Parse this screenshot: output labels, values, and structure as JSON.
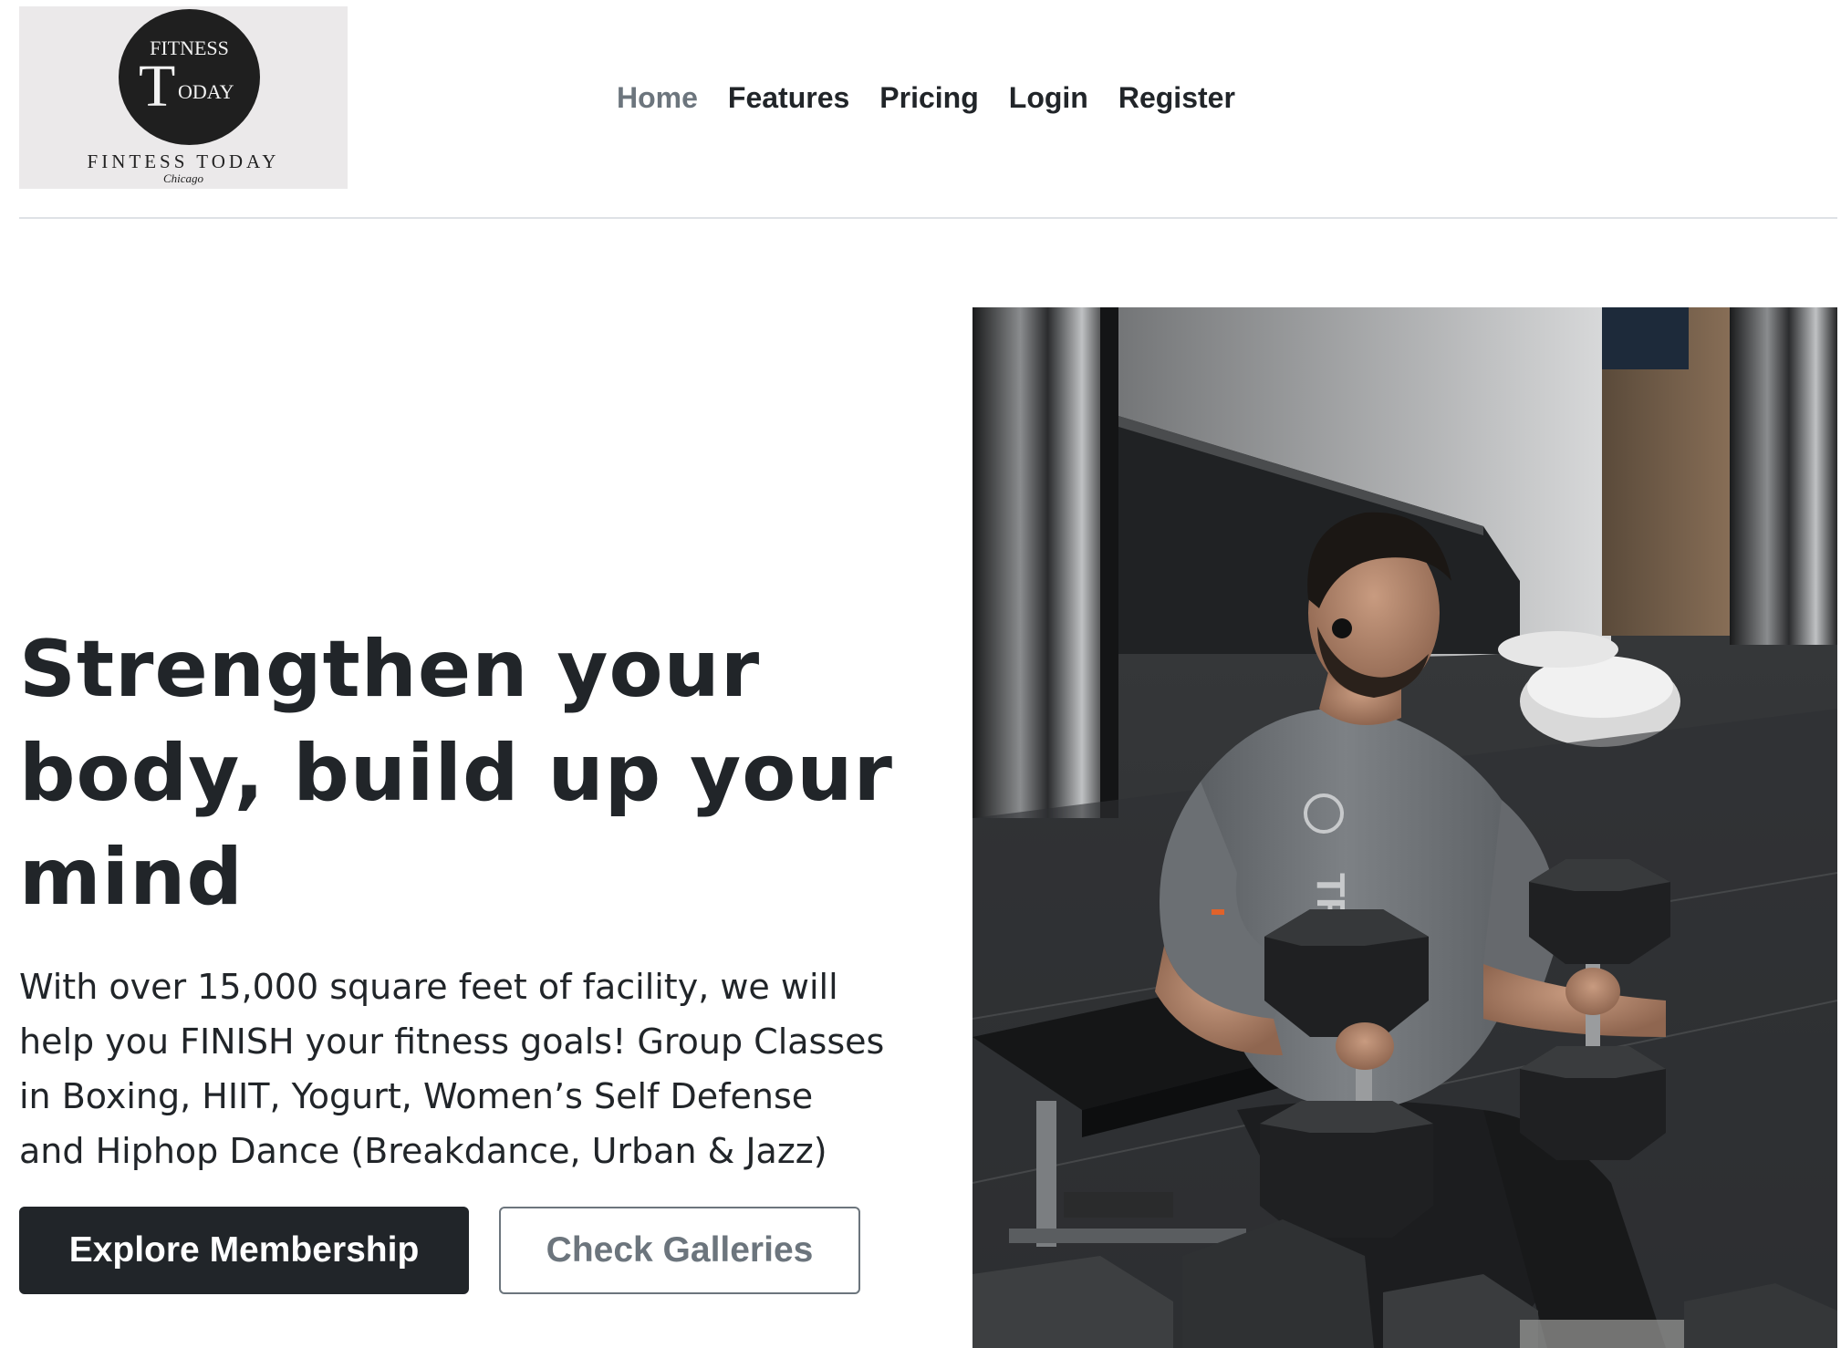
{
  "logo": {
    "top_text": "FITNESS",
    "big_letter": "T",
    "rest_text": "ODAY",
    "name": "FINTESS TODAY",
    "city": "Chicago",
    "colors": {
      "background": "#ebe9ea",
      "circle": "#1f1f1f"
    }
  },
  "nav": {
    "items": [
      {
        "label": "Home",
        "active": true
      },
      {
        "label": "Features",
        "active": false
      },
      {
        "label": "Pricing",
        "active": false
      },
      {
        "label": "Login",
        "active": false
      },
      {
        "label": "Register",
        "active": false
      }
    ]
  },
  "hero": {
    "title": "Strengthen your body, build up your mind",
    "description": "With over 15,000 square feet of facility, we will help you FINISH your fitness goals! Group Classes in Boxing, HIIT, Yogurt, Women’s Self Defense and Hiphop Dance (Breakdance, Urban & Jazz)",
    "primary_button": "Explore Membership",
    "secondary_button": "Check Galleries",
    "image_icon": "man-lifting-dumbbells-photo",
    "shirt_print": "TR"
  },
  "colors": {
    "text": "#212529",
    "muted": "#6c757d",
    "divider": "#dee2e6"
  }
}
